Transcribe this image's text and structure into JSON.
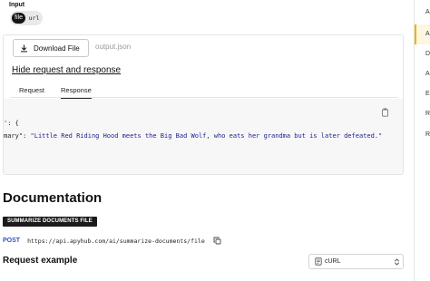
{
  "input": {
    "label": "Input",
    "options": [
      "file",
      "url"
    ],
    "selected": "file"
  },
  "download": {
    "button_label": "Download File",
    "filename": "output.json"
  },
  "toggle_link": "Hide request and response",
  "tabs": [
    {
      "label": "Request",
      "active": false
    },
    {
      "label": "Response",
      "active": true
    }
  ],
  "response_code": {
    "line1": "': {",
    "line2_key": "mary\": ",
    "line2_value": "\"Little Red Riding Hood meets the Big Bad Wolf, who eats her grandma but is later defeated.\""
  },
  "documentation": {
    "title": "Documentation",
    "badge": "SUMMARIZE DOCUMENTS FILE",
    "method": "POST",
    "url": "https://api.apyhub.com/ai/summarize-documents/file"
  },
  "request_example": {
    "title": "Request example",
    "language": "cURL"
  },
  "sidebar": {
    "items": [
      "A",
      "A",
      "D",
      "A",
      "E",
      "R",
      "R"
    ]
  },
  "colors": {
    "accent": "#eab308",
    "method": "#2b56c6",
    "string": "#21218f"
  }
}
